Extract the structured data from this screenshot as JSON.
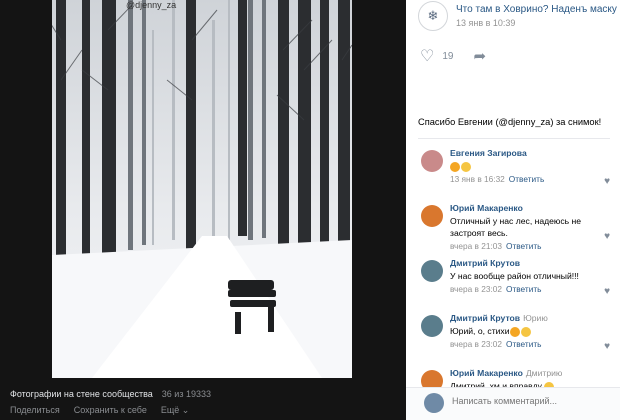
{
  "viewer": {
    "watermark": "@djenny_za",
    "album_label": "Фотографии на стене сообщества",
    "counter": "36 из 19333",
    "actions": {
      "share": "Поделиться",
      "save": "Сохранить к себе",
      "more": "Ещё"
    }
  },
  "post": {
    "group_name": "Что там в Ховрино? Наденъ маску",
    "date": "13 янв в 10:39",
    "likes_count": "19",
    "text": "Спасибо Евгении (@djenny_za) за снимок!"
  },
  "comments": [
    {
      "author": "Евгения Загирова",
      "reply_to": "",
      "text": "",
      "date": "13 янв в 16:32",
      "reply_label": "Ответить",
      "avatar_color": "#c98a8a",
      "emoji": [
        "orange",
        "yellow"
      ]
    },
    {
      "author": "Юрий Макаренко",
      "reply_to": "",
      "text": "Отличный у нас лес, надеюсь не застроят весь.",
      "date": "вчера в 21:03",
      "reply_label": "Ответить",
      "avatar_color": "#d9772e",
      "emoji": []
    },
    {
      "author": "Дмитрий Крутов",
      "reply_to": "",
      "text": "У нас вообще район отличный!!!",
      "date": "вчера в 23:02",
      "reply_label": "Ответить",
      "avatar_color": "#5a7d8c",
      "emoji": []
    },
    {
      "author": "Дмитрий Крутов",
      "reply_to": "Юрию",
      "text": "Юрий, о, стихи",
      "date": "вчера в 23:02",
      "reply_label": "Ответить",
      "avatar_color": "#5a7d8c",
      "emoji": [
        "orange",
        "yellow"
      ]
    },
    {
      "author": "Юрий Макаренко",
      "reply_to": "Дмитрию",
      "text": "Дмитрий, хм и вправду",
      "date": "",
      "reply_label": "",
      "avatar_color": "#d9772e",
      "emoji": [
        "yellow"
      ]
    }
  ],
  "reply_box": {
    "placeholder": "Написать комментарий..."
  }
}
